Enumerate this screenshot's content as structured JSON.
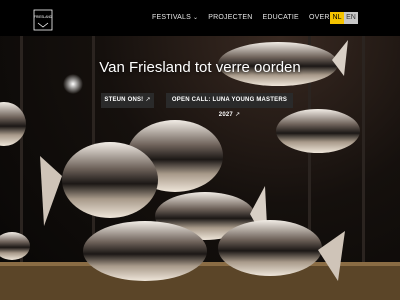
{
  "header": {
    "logo_text": "FRIESLAND",
    "nav": [
      {
        "label": "FESTIVALS",
        "has_dropdown": true
      },
      {
        "label": "PROJECTEN",
        "has_dropdown": false
      },
      {
        "label": "EDUCATIE",
        "has_dropdown": false
      },
      {
        "label": "OVER ONS",
        "has_dropdown": true
      }
    ],
    "languages": {
      "active": "NL",
      "other": "EN"
    }
  },
  "hero": {
    "title": "Van Friesland tot verre oorden",
    "buttons": [
      {
        "label": "STEUN ONS!"
      },
      {
        "label": "OPEN CALL: LUNA YOUNG MASTERS 2027"
      }
    ]
  },
  "colors": {
    "accent": "#f5c400",
    "button_bg": "#2a2a2a"
  }
}
